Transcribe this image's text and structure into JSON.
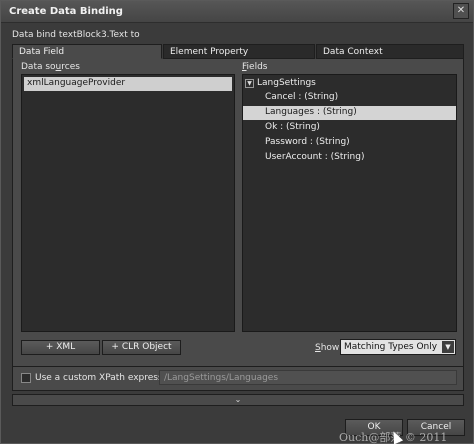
{
  "window": {
    "title": "Create Data Binding",
    "close_glyph": "✕"
  },
  "subtitle": "Data bind textBlock3.Text to",
  "tabs": [
    {
      "label": "Data Field",
      "active": true
    },
    {
      "label": "Element Property",
      "active": false
    },
    {
      "label": "Data Context",
      "active": false
    }
  ],
  "data_sources": {
    "label_prefix": "Data so",
    "label_underline": "u",
    "label_suffix": "rces",
    "items": [
      "xmlLanguageProvider"
    ]
  },
  "fields": {
    "label_underline": "F",
    "label_suffix": "ields",
    "root": "LangSettings",
    "expander_glyph": "▼",
    "items": [
      {
        "label": "Cancel : (String)",
        "selected": false
      },
      {
        "label": "Languages : (String)",
        "selected": true
      },
      {
        "label": "Ok : (String)",
        "selected": false
      },
      {
        "label": "Password : (String)",
        "selected": false
      },
      {
        "label": "UserAccount : (String)",
        "selected": false
      }
    ]
  },
  "buttons": {
    "add_xml": "+ XML",
    "add_clr": "+ CLR Object",
    "ok": "OK",
    "cancel": "Cancel"
  },
  "show": {
    "label_underline": "S",
    "label_suffix": "how",
    "selected": "Matching Types Only",
    "arrow_glyph": "▼"
  },
  "xpath": {
    "label": "Use a custom XPath expression",
    "value": "/LangSettings/Languages",
    "checked": false
  },
  "expand_glyph": "⌄",
  "watermark": "Ouch@部落 © 2011"
}
